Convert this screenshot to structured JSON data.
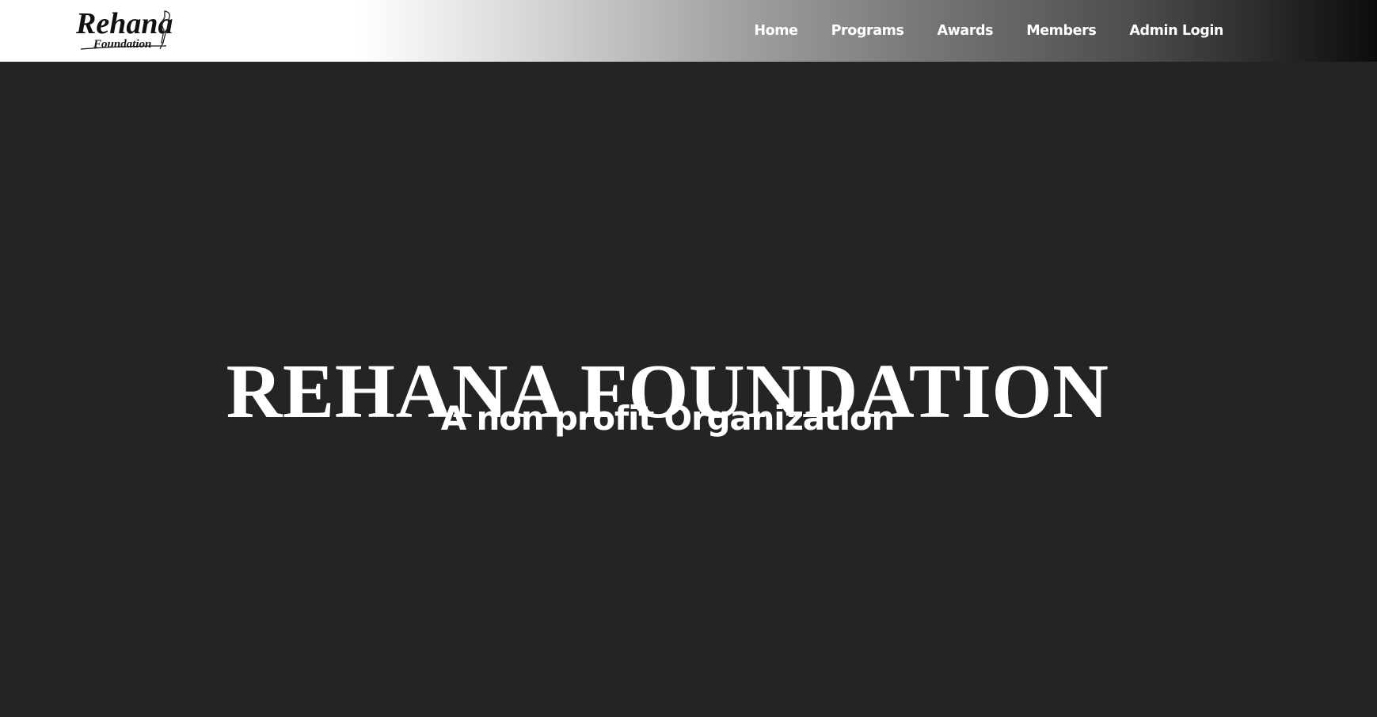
{
  "header": {
    "logo": {
      "text_main": "Rehana",
      "text_sub": "Foundation",
      "icon": "quill-pen-icon"
    },
    "nav": [
      {
        "label": "Home"
      },
      {
        "label": "Programs"
      },
      {
        "label": "Awards"
      },
      {
        "label": "Members"
      },
      {
        "label": "Admin Login"
      }
    ]
  },
  "hero": {
    "title": "REHANA FOUNDATION",
    "subtitle": "A non profit Organization"
  },
  "colors": {
    "hero_background": "#242424",
    "text": "#ffffff"
  }
}
